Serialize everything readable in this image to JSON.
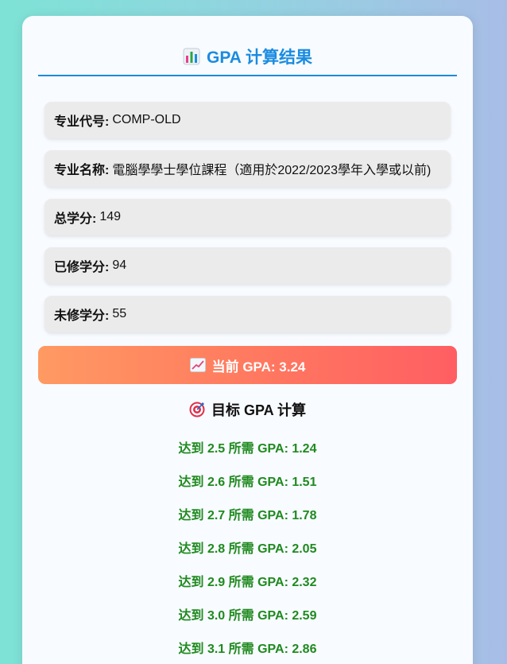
{
  "header": {
    "title": "GPA 计算结果",
    "icon": "bar-chart-icon"
  },
  "info": [
    {
      "label": "专业代号:",
      "value": "COMP-OLD"
    },
    {
      "label": "专业名称:",
      "value": "電腦學學士學位課程（適用於2022/2023學年入學或以前)"
    },
    {
      "label": "总学分:",
      "value": "149"
    },
    {
      "label": "已修学分:",
      "value": "94"
    },
    {
      "label": "未修学分:",
      "value": "55"
    }
  ],
  "current_gpa": {
    "text": "当前 GPA: 3.24",
    "icon": "trending-up-icon"
  },
  "target": {
    "heading": "目标 GPA 计算",
    "icon": "target-icon",
    "items": [
      "达到 2.5 所需 GPA: 1.24",
      "达到 2.6 所需 GPA: 1.51",
      "达到 2.7 所需 GPA: 1.78",
      "达到 2.8 所需 GPA: 2.05",
      "达到 2.9 所需 GPA: 2.32",
      "达到 3.0 所需 GPA: 2.59",
      "达到 3.1 所需 GPA: 2.86"
    ]
  },
  "colors": {
    "accent": "#1a8ce0",
    "banner_start": "#ff9a62",
    "banner_end": "#ff5e62",
    "target_text": "#1f8a1f"
  }
}
